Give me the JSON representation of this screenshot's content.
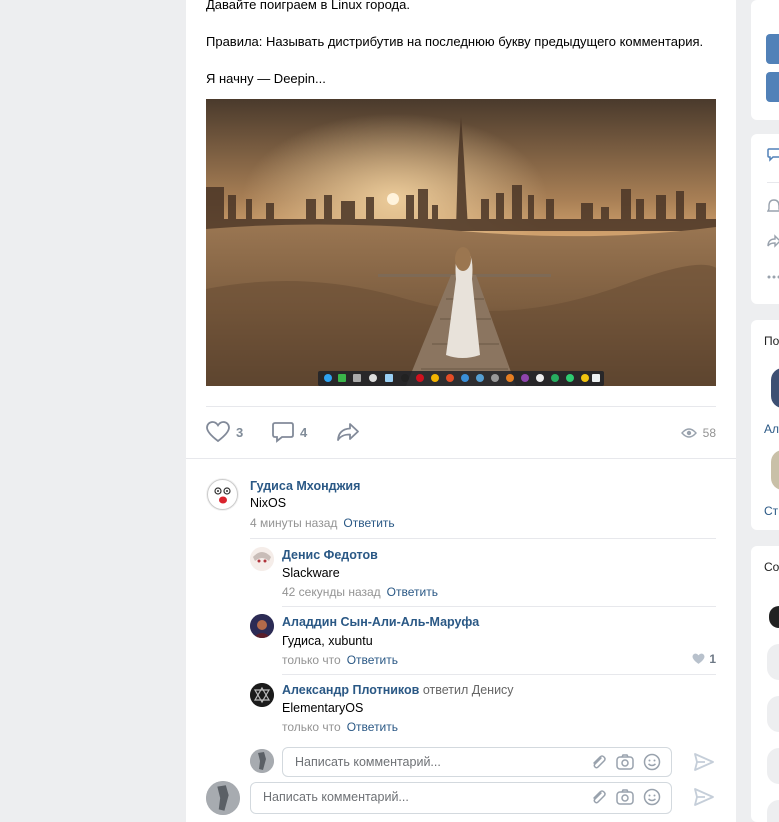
{
  "post": {
    "line1": "Давайте поиграем в Linux города.",
    "line2": "Правила: Называть дистрибутив на последнюю букву предыдущего комментария.",
    "line3": "Я начну — Deepin..."
  },
  "actions": {
    "likes": "3",
    "comments": "4",
    "views": "58"
  },
  "comments": [
    {
      "author": "Гудиса Мхонджия",
      "text": "NixOS",
      "time": "4 минуты назад",
      "reply": "Ответить"
    },
    {
      "author": "Денис Федотов",
      "text": "Slackware",
      "time": "42 секунды назад",
      "reply": "Ответить"
    },
    {
      "author": "Аладдин Сын-Али-Аль-Маруфа",
      "text": "Гудиса, xubuntu",
      "time": "только что",
      "reply": "Ответить",
      "likes": "1"
    },
    {
      "author": "Александр Плотников",
      "replied_to": "ответил Денису",
      "text": "ElementaryOS",
      "time": "только что",
      "reply": "Ответить"
    }
  ],
  "inputs": {
    "reply_placeholder": "Написать комментарий...",
    "main_placeholder": "Написать комментарий..."
  },
  "sidebar": {
    "label1": "По",
    "label2": "Ал",
    "label3": "Ст",
    "label4": "Со"
  },
  "colors": {
    "link": "#2a5885",
    "accent": "#5181b8",
    "background": "#edeef0"
  }
}
